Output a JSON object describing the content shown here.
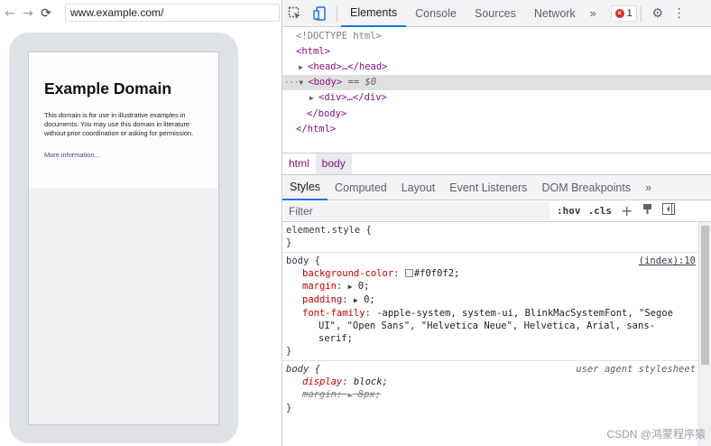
{
  "browser": {
    "back_icon": "←",
    "forward_icon": "→",
    "reload_icon": "⟳",
    "url": "www.example.com/"
  },
  "page": {
    "title": "Example Domain",
    "body": "This domain is for use in illustrative examples in documents. You may use this domain in literature without prior coordination or asking for permission.",
    "link": "More information..."
  },
  "devtools": {
    "tabs": [
      "Elements",
      "Console",
      "Sources",
      "Network"
    ],
    "more": "»",
    "error_count": "1",
    "dom": {
      "doctype": "<!DOCTYPE html>",
      "html_open": "<html>",
      "head": "<head>…</head>",
      "body_open": "<body>",
      "body_marker": "== $0",
      "div": "<div>…</div>",
      "body_close": "</body>",
      "html_close": "</html>",
      "dots": "···"
    },
    "breadcrumbs": [
      "html",
      "body"
    ],
    "subtabs": [
      "Styles",
      "Computed",
      "Layout",
      "Event Listeners",
      "DOM Breakpoints"
    ],
    "subtabs_more": "»",
    "filter_placeholder": "Filter",
    "hov": ":hov",
    "cls": ".cls",
    "styles": {
      "element_style": "element.style {",
      "close": "}",
      "body_selector": "body {",
      "body_source": "(index):10",
      "bg_name": "background-color",
      "bg_value": "#f0f0f2;",
      "margin_name": "margin",
      "margin_value": "0;",
      "padding_name": "padding",
      "padding_value": "0;",
      "font_name": "font-family",
      "font_value_1": "-apple-system, system-ui, BlinkMacSystemFont, \"Segoe",
      "font_value_2": "UI\", \"Open Sans\", \"Helvetica Neue\", Helvetica, Arial, sans-",
      "font_value_3": "serif;",
      "ua_selector": "body {",
      "ua_source": "user agent stylesheet",
      "display_name": "display",
      "display_value": "block;",
      "ua_margin_name": "margin",
      "ua_margin_value": "8px;"
    }
  },
  "watermark": "CSDN @鸿蒙程序猿"
}
